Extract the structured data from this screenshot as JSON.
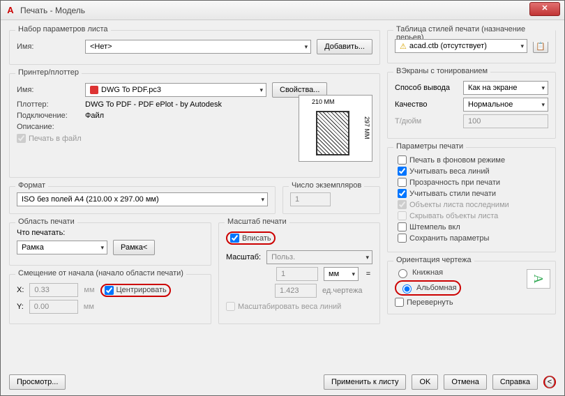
{
  "window": {
    "title": "Печать - Модель"
  },
  "pageSetup": {
    "title": "Набор параметров листа",
    "nameLabel": "Имя:",
    "name": "<Нет>",
    "addBtn": "Добавить..."
  },
  "printer": {
    "title": "Принтер/плоттер",
    "nameLabel": "Имя:",
    "name": "DWG To PDF.pc3",
    "propsBtn": "Свойства...",
    "plotterLabel": "Плоттер:",
    "plotter": "DWG To PDF - PDF ePlot - by Autodesk",
    "connLabel": "Подключение:",
    "conn": "Файл",
    "descLabel": "Описание:",
    "toFile": "Печать в файл",
    "preview": {
      "top": "210 MM",
      "right": "297 MM"
    }
  },
  "format": {
    "title": "Формат",
    "value": "ISO без полей A4 (210.00 x 297.00 мм)",
    "copiesTitle": "Число экземпляров",
    "copies": "1"
  },
  "area": {
    "title": "Область печати",
    "whatLabel": "Что печатать:",
    "what": "Рамка",
    "windowBtn": "Рамка<"
  },
  "scale": {
    "title": "Масштаб печати",
    "fit": "Вписать",
    "scaleLabel": "Масштаб:",
    "scale": "Польз.",
    "val1": "1",
    "unit": "мм",
    "val2": "1.423",
    "unitLabel": "ед.чертежа",
    "weights": "Масштабировать веса линий"
  },
  "offset": {
    "title": "Смещение от начала (начало области печати)",
    "xLabel": "X:",
    "x": "0.33",
    "yLabel": "Y:",
    "y": "0.00",
    "unit": "мм",
    "center": "Центрировать"
  },
  "plotStyles": {
    "title": "Таблица стилей печати (назначение перьев)",
    "value": "acad.ctb (отсутствует)"
  },
  "shaded": {
    "title": "ВЭкраны с тонированием",
    "methodLabel": "Способ вывода",
    "method": "Как на экране",
    "qualityLabel": "Качество",
    "quality": "Нормальное",
    "dpiLabel": "Т/дюйм",
    "dpi": "100"
  },
  "options": {
    "title": "Параметры печати",
    "items": [
      {
        "label": "Печать в фоновом режиме",
        "checked": false,
        "disabled": false
      },
      {
        "label": "Учитывать веса линий",
        "checked": true,
        "disabled": false
      },
      {
        "label": "Прозрачность при печати",
        "checked": false,
        "disabled": false
      },
      {
        "label": "Учитывать стили печати",
        "checked": true,
        "disabled": false
      },
      {
        "label": "Объекты листа последними",
        "checked": true,
        "disabled": true
      },
      {
        "label": "Скрывать объекты листа",
        "checked": false,
        "disabled": true
      },
      {
        "label": "Штемпель вкл",
        "checked": false,
        "disabled": false
      },
      {
        "label": "Сохранить параметры",
        "checked": false,
        "disabled": false
      }
    ]
  },
  "orient": {
    "title": "Ориентация чертежа",
    "portrait": "Книжная",
    "landscape": "Альбомная",
    "upside": "Перевернуть"
  },
  "footer": {
    "preview": "Просмотр...",
    "apply": "Применить к листу",
    "ok": "OK",
    "cancel": "Отмена",
    "help": "Справка"
  }
}
